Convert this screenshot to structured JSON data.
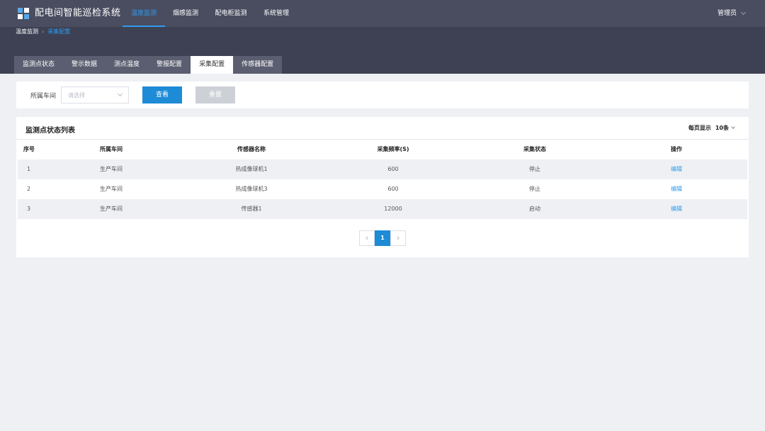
{
  "app": {
    "title": "配电间智能巡检系统"
  },
  "topnav": [
    {
      "label": "温度监测",
      "active": true
    },
    {
      "label": "烟感监测",
      "active": false
    },
    {
      "label": "配电柜监测",
      "active": false
    },
    {
      "label": "系统管理",
      "active": false
    }
  ],
  "user": {
    "name": "管理员"
  },
  "breadcrumb": {
    "parent": "温度监测",
    "current": "采集配置"
  },
  "tabs": [
    {
      "label": "监测点状态",
      "active": false
    },
    {
      "label": "警示数据",
      "active": false
    },
    {
      "label": "测点温度",
      "active": false
    },
    {
      "label": "警报配置",
      "active": false
    },
    {
      "label": "采集配置",
      "active": true
    },
    {
      "label": "传感器配置",
      "active": false
    }
  ],
  "filter": {
    "label": "所属车间",
    "placeholder": "请选择",
    "search_label": "查看",
    "reset_label": "重置"
  },
  "table": {
    "title": "监测点状态列表",
    "page_size_label": "每页显示",
    "page_size_value": "10条",
    "columns": [
      "序号",
      "所属车间",
      "传感器名称",
      "采集频率(S)",
      "采集状态",
      "操作"
    ],
    "rows": [
      {
        "index": "1",
        "workshop": "生产车间",
        "sensor": "热成像球机1",
        "frequency": "600",
        "status": "停止",
        "action": "编辑"
      },
      {
        "index": "2",
        "workshop": "生产车间",
        "sensor": "热成像球机3",
        "frequency": "600",
        "status": "停止",
        "action": "编辑"
      },
      {
        "index": "3",
        "workshop": "生产车间",
        "sensor": "传感器1",
        "frequency": "12000",
        "status": "启动",
        "action": "编辑"
      }
    ]
  },
  "pagination": {
    "current_page": "1"
  },
  "colors": {
    "accent": "#1d8bd6",
    "topbar": "#4a4d60",
    "subband": "#3e4154",
    "link": "#2f9bec"
  }
}
